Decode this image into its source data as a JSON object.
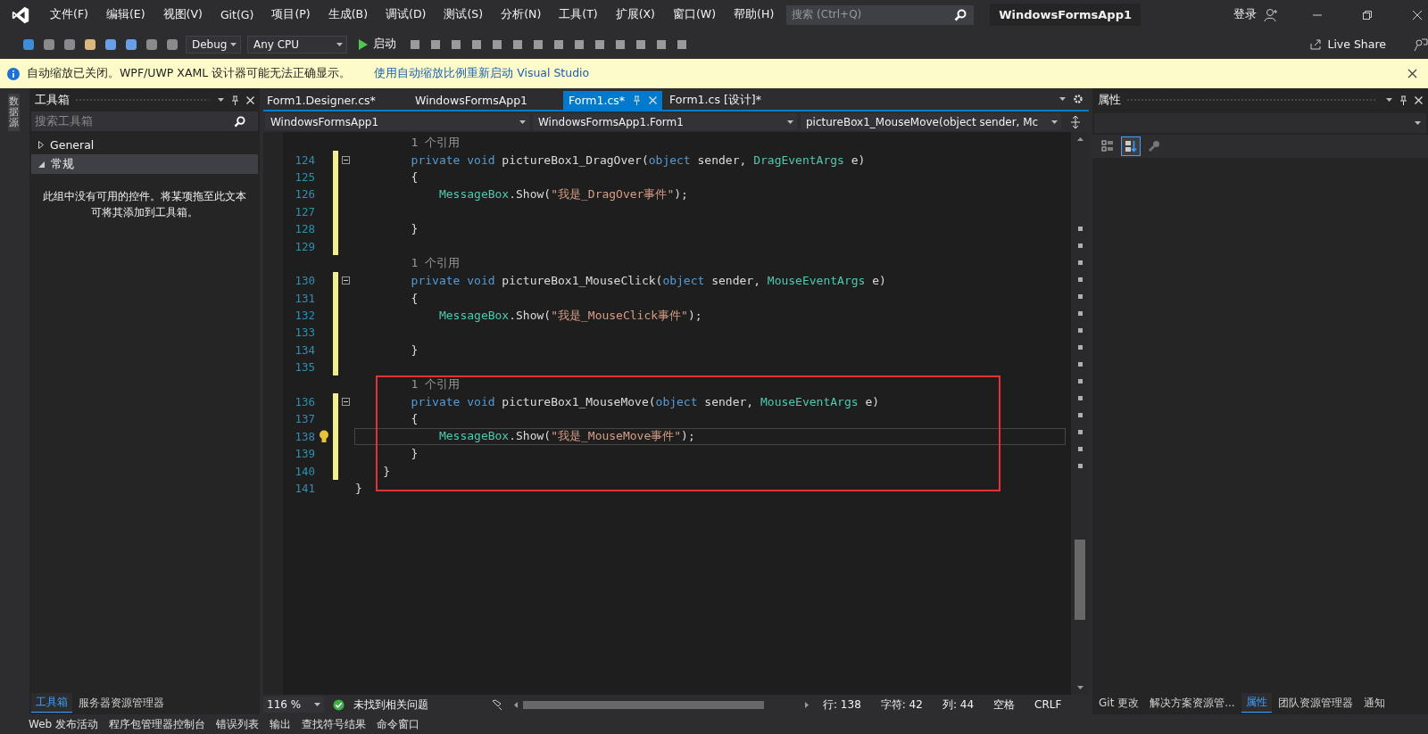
{
  "window": {
    "title": "WindowsFormsApp1",
    "search_placeholder": "搜索 (Ctrl+Q)",
    "sign_in": "登录"
  },
  "menu": [
    "文件(F)",
    "编辑(E)",
    "视图(V)",
    "Git(G)",
    "项目(P)",
    "生成(B)",
    "调试(D)",
    "测试(S)",
    "分析(N)",
    "工具(T)",
    "扩展(X)",
    "窗口(W)",
    "帮助(H)"
  ],
  "toolbar": {
    "configuration": "Debug",
    "platform": "Any CPU",
    "start": "启动",
    "live_share": "Live Share"
  },
  "infobar": {
    "message": "自动缩放已关闭。WPF/UWP XAML 设计器可能无法正确显示。",
    "link": "使用自动缩放比例重新启动 Visual Studio"
  },
  "side_strip": "数据源",
  "toolbox": {
    "title": "工具箱",
    "search_placeholder": "搜索工具箱",
    "groups": [
      {
        "label": "General",
        "expanded": false,
        "selected": false
      },
      {
        "label": "常规",
        "expanded": true,
        "selected": true
      }
    ],
    "empty_text": "此组中没有可用的控件。将某项拖至此文本可将其添加到工具箱。",
    "tabs": [
      {
        "label": "工具箱",
        "selected": true
      },
      {
        "label": "服务器资源管理器",
        "selected": false
      }
    ]
  },
  "doc_tabs": [
    {
      "label": "Form1.Designer.cs*",
      "selected": false
    },
    {
      "label": "WindowsFormsApp1",
      "selected": false
    },
    {
      "label": "Form1.cs*",
      "selected": true
    },
    {
      "label": "Form1.cs [设计]*",
      "selected": false
    }
  ],
  "nav_bar": [
    "WindowsFormsApp1",
    "WindowsFormsApp1.Form1",
    "pictureBox1_MouseMove(object sender, Mc"
  ],
  "code": [
    {
      "boxed": false,
      "rows": [
        {
          "kind": "codelens",
          "tokens": [
            {
              "kind": "lens",
              "text": "        1 个引用"
            }
          ]
        },
        {
          "kind": "code",
          "number": "124",
          "changed": true,
          "fold": true,
          "current": false,
          "lightbulb": false,
          "tokens": [
            {
              "kind": "kw",
              "text": "        private void"
            },
            {
              "kind": "plain",
              "text": " pictureBox1_DragOver("
            },
            {
              "kind": "kw",
              "text": "object"
            },
            {
              "kind": "plain",
              "text": " sender, "
            },
            {
              "kind": "type",
              "text": "DragEventArgs"
            },
            {
              "kind": "plain",
              "text": " e)"
            }
          ]
        },
        {
          "kind": "code",
          "number": "125",
          "changed": true,
          "fold": false,
          "current": false,
          "lightbulb": false,
          "tokens": [
            {
              "kind": "plain",
              "text": "        {"
            }
          ]
        },
        {
          "kind": "code",
          "number": "126",
          "changed": true,
          "fold": false,
          "current": false,
          "lightbulb": false,
          "tokens": [
            {
              "kind": "type",
              "text": "            MessageBox"
            },
            {
              "kind": "plain",
              "text": ".Show("
            },
            {
              "kind": "str",
              "text": "\"我是_DragOver事件\""
            },
            {
              "kind": "plain",
              "text": ");"
            }
          ]
        },
        {
          "kind": "code",
          "number": "127",
          "changed": true,
          "fold": false,
          "current": false,
          "lightbulb": false
        },
        {
          "kind": "code",
          "number": "128",
          "changed": true,
          "fold": false,
          "current": false,
          "lightbulb": false,
          "tokens": [
            {
              "kind": "plain",
              "text": "        }"
            }
          ]
        },
        {
          "kind": "code",
          "number": "129",
          "changed": true,
          "fold": false,
          "current": false,
          "lightbulb": false
        },
        {
          "kind": "codelens",
          "tokens": [
            {
              "kind": "lens",
              "text": "        1 个引用"
            }
          ]
        },
        {
          "kind": "code",
          "number": "130",
          "changed": true,
          "fold": true,
          "current": false,
          "lightbulb": false,
          "tokens": [
            {
              "kind": "kw",
              "text": "        private void"
            },
            {
              "kind": "plain",
              "text": " pictureBox1_MouseClick("
            },
            {
              "kind": "kw",
              "text": "object"
            },
            {
              "kind": "plain",
              "text": " sender, "
            },
            {
              "kind": "type",
              "text": "MouseEventArgs"
            },
            {
              "kind": "plain",
              "text": " e)"
            }
          ]
        },
        {
          "kind": "code",
          "number": "131",
          "changed": true,
          "fold": false,
          "current": false,
          "lightbulb": false,
          "tokens": [
            {
              "kind": "plain",
              "text": "        {"
            }
          ]
        },
        {
          "kind": "code",
          "number": "132",
          "changed": true,
          "fold": false,
          "current": false,
          "lightbulb": false,
          "tokens": [
            {
              "kind": "type",
              "text": "            MessageBox"
            },
            {
              "kind": "plain",
              "text": ".Show("
            },
            {
              "kind": "str",
              "text": "\"我是_MouseClick事件\""
            },
            {
              "kind": "plain",
              "text": ");"
            }
          ]
        },
        {
          "kind": "code",
          "number": "133",
          "changed": true,
          "fold": false,
          "current": false,
          "lightbulb": false
        },
        {
          "kind": "code",
          "number": "134",
          "changed": true,
          "fold": false,
          "current": false,
          "lightbulb": false,
          "tokens": [
            {
              "kind": "plain",
              "text": "        }"
            }
          ]
        },
        {
          "kind": "code",
          "number": "135",
          "changed": true,
          "fold": false,
          "current": false,
          "lightbulb": false
        }
      ]
    },
    {
      "boxed": true,
      "rows": [
        {
          "kind": "codelens",
          "tokens": [
            {
              "kind": "lens",
              "text": "        1 个引用"
            }
          ]
        },
        {
          "kind": "code",
          "number": "136",
          "changed": true,
          "fold": true,
          "current": false,
          "lightbulb": false,
          "tokens": [
            {
              "kind": "kw",
              "text": "        private void"
            },
            {
              "kind": "plain",
              "text": " pictureBox1_MouseMove("
            },
            {
              "kind": "kw",
              "text": "object"
            },
            {
              "kind": "plain",
              "text": " sender, "
            },
            {
              "kind": "type",
              "text": "MouseEventArgs"
            },
            {
              "kind": "plain",
              "text": " e)"
            }
          ]
        },
        {
          "kind": "code",
          "number": "137",
          "changed": true,
          "fold": false,
          "current": false,
          "lightbulb": false,
          "tokens": [
            {
              "kind": "plain",
              "text": "        {"
            }
          ]
        },
        {
          "kind": "code",
          "number": "138",
          "changed": true,
          "fold": false,
          "current": true,
          "lightbulb": true,
          "tokens": [
            {
              "kind": "type",
              "text": "            MessageBox"
            },
            {
              "kind": "plain",
              "text": ".Show("
            },
            {
              "kind": "str",
              "text": "\"我是_MouseMove事件\""
            },
            {
              "kind": "plain",
              "text": ");"
            }
          ]
        },
        {
          "kind": "code",
          "number": "139",
          "changed": true,
          "fold": false,
          "current": false,
          "lightbulb": false,
          "tokens": [
            {
              "kind": "plain",
              "text": "        }"
            }
          ]
        },
        {
          "kind": "code",
          "number": "140",
          "changed": true,
          "fold": false,
          "current": false,
          "lightbulb": false,
          "tokens": [
            {
              "kind": "plain",
              "text": "    }"
            }
          ]
        },
        {
          "kind": "code",
          "number": "141",
          "changed": false,
          "fold": false,
          "current": false,
          "lightbulb": false,
          "tokens": [
            {
              "kind": "plain",
              "text": "}"
            }
          ]
        }
      ]
    }
  ],
  "editor_status": {
    "zoom": "116 %",
    "issues": "未找到相关问题",
    "line": "行: 138",
    "char": "字符: 42",
    "col": "列: 44",
    "whitespace": "空格",
    "line_ending": "CRLF"
  },
  "properties": {
    "title": "属性",
    "buttons": [
      {
        "kind": "categorized",
        "selected": false
      },
      {
        "kind": "alphabetical",
        "selected": true
      },
      {
        "kind": "pages",
        "selected": false
      }
    ]
  },
  "right_tabs": [
    {
      "label": "Git 更改",
      "selected": false
    },
    {
      "label": "解决方案资源管...",
      "selected": false
    },
    {
      "label": "属性",
      "selected": true
    },
    {
      "label": "团队资源管理器",
      "selected": false
    },
    {
      "label": "通知",
      "selected": false
    }
  ],
  "bottom_tabs": [
    "Web 发布活动",
    "程序包管理器控制台",
    "错误列表",
    "输出",
    "查找符号结果",
    "命令窗口"
  ]
}
